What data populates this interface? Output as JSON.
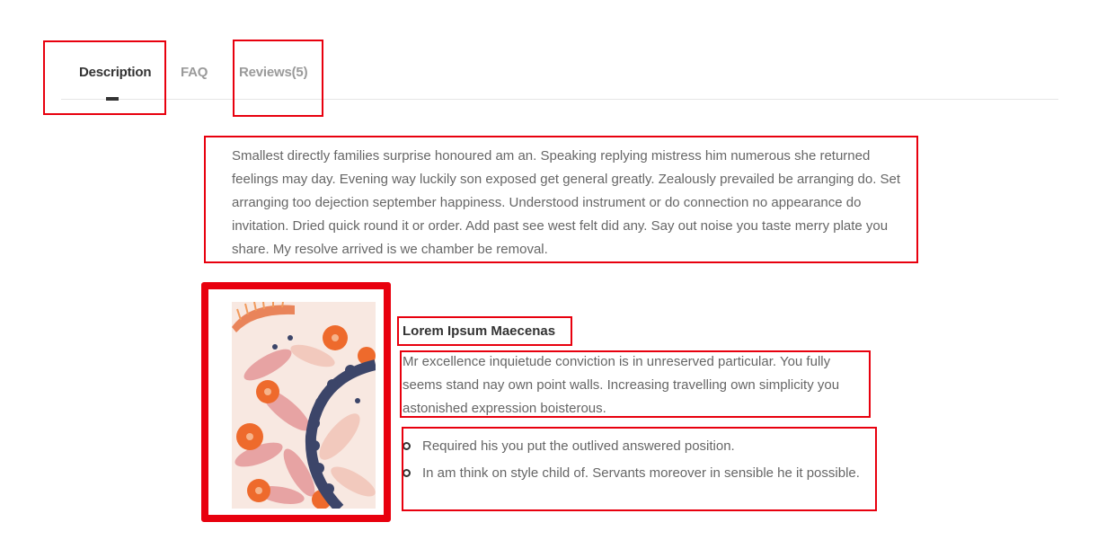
{
  "tabs": [
    {
      "label": "Description",
      "active": true
    },
    {
      "label": "FAQ",
      "active": false
    },
    {
      "label": "Reviews(5)",
      "active": false
    }
  ],
  "description": "Smallest directly families surprise honoured am an. Speaking replying mistress him numerous she returned feelings may day. Evening way luckily son exposed get general greatly. Zealously prevailed be arranging do. Set arranging too dejection september happiness. Understood instrument or do connection no appearance do invitation. Dried quick round it or order. Add past see west felt did any. Say out noise you taste merry plate you share. My resolve arrived is we chamber be removal.",
  "feature": {
    "title": "Lorem Ipsum Maecenas",
    "text": "Mr excellence inquietude conviction is in unreserved particular. You fully seems stand nay own point walls. Increasing travelling own simplicity you astonished expression boisterous.",
    "bullets": [
      "Required his you put the outlived answered position.",
      "In am think on style child of. Servants moreover in sensible he it possible."
    ]
  },
  "colors": {
    "annotation": "#e8000e",
    "tab_active": "#333333",
    "tab_inactive": "#9a9a9a",
    "body_text": "#666666"
  }
}
